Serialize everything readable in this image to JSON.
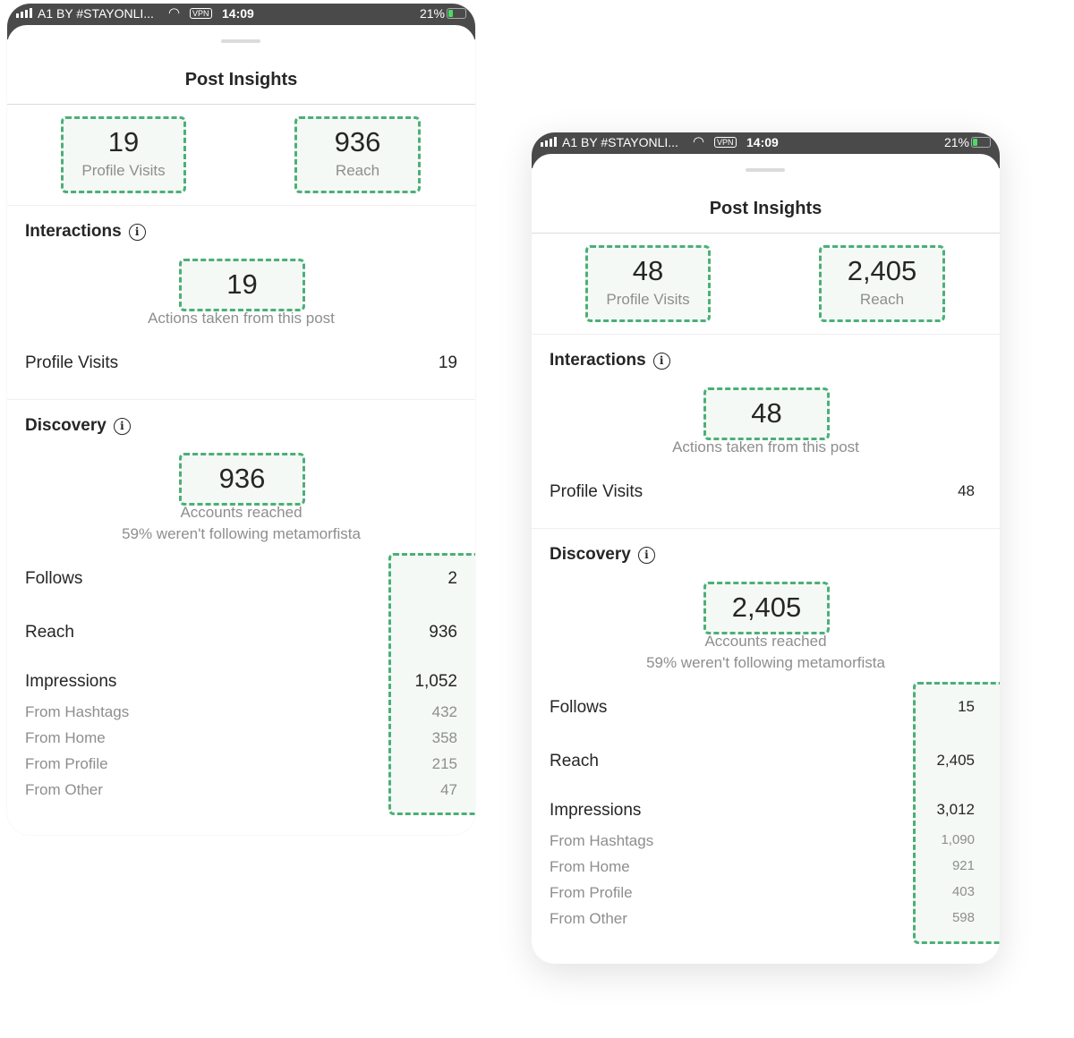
{
  "status_bar": {
    "carrier": "A1 BY #STAYONLI...",
    "vpn": "VPN",
    "time": "14:09",
    "battery": "21%"
  },
  "accent_color": "#4caf78",
  "phones": [
    {
      "title": "Post Insights",
      "top": {
        "profile_visits": "19",
        "profile_visits_label": "Profile Visits",
        "reach": "936",
        "reach_label": "Reach"
      },
      "interactions": {
        "heading": "Interactions",
        "value": "19",
        "caption": "Actions taken from this post",
        "rows": [
          {
            "label": "Profile Visits",
            "value": "19"
          }
        ]
      },
      "discovery": {
        "heading": "Discovery",
        "value": "936",
        "caption": "Accounts reached",
        "note": "59% weren't following metamorfista",
        "follows": {
          "label": "Follows",
          "value": "2"
        },
        "reach": {
          "label": "Reach",
          "value": "936"
        },
        "impressions": {
          "label": "Impressions",
          "value": "1,052"
        },
        "sources": [
          {
            "label": "From Hashtags",
            "value": "432"
          },
          {
            "label": "From Home",
            "value": "358"
          },
          {
            "label": "From Profile",
            "value": "215"
          },
          {
            "label": "From Other",
            "value": "47"
          }
        ]
      }
    },
    {
      "title": "Post Insights",
      "top": {
        "profile_visits": "48",
        "profile_visits_label": "Profile Visits",
        "reach": "2,405",
        "reach_label": "Reach"
      },
      "interactions": {
        "heading": "Interactions",
        "value": "48",
        "caption": "Actions taken from this post",
        "rows": [
          {
            "label": "Profile Visits",
            "value": "48"
          }
        ]
      },
      "discovery": {
        "heading": "Discovery",
        "value": "2,405",
        "caption": "Accounts reached",
        "note": "59% weren't following metamorfista",
        "follows": {
          "label": "Follows",
          "value": "15"
        },
        "reach": {
          "label": "Reach",
          "value": "2,405"
        },
        "impressions": {
          "label": "Impressions",
          "value": "3,012"
        },
        "sources": [
          {
            "label": "From Hashtags",
            "value": "1,090"
          },
          {
            "label": "From Home",
            "value": "921"
          },
          {
            "label": "From Profile",
            "value": "403"
          },
          {
            "label": "From Other",
            "value": "598"
          }
        ]
      }
    }
  ]
}
